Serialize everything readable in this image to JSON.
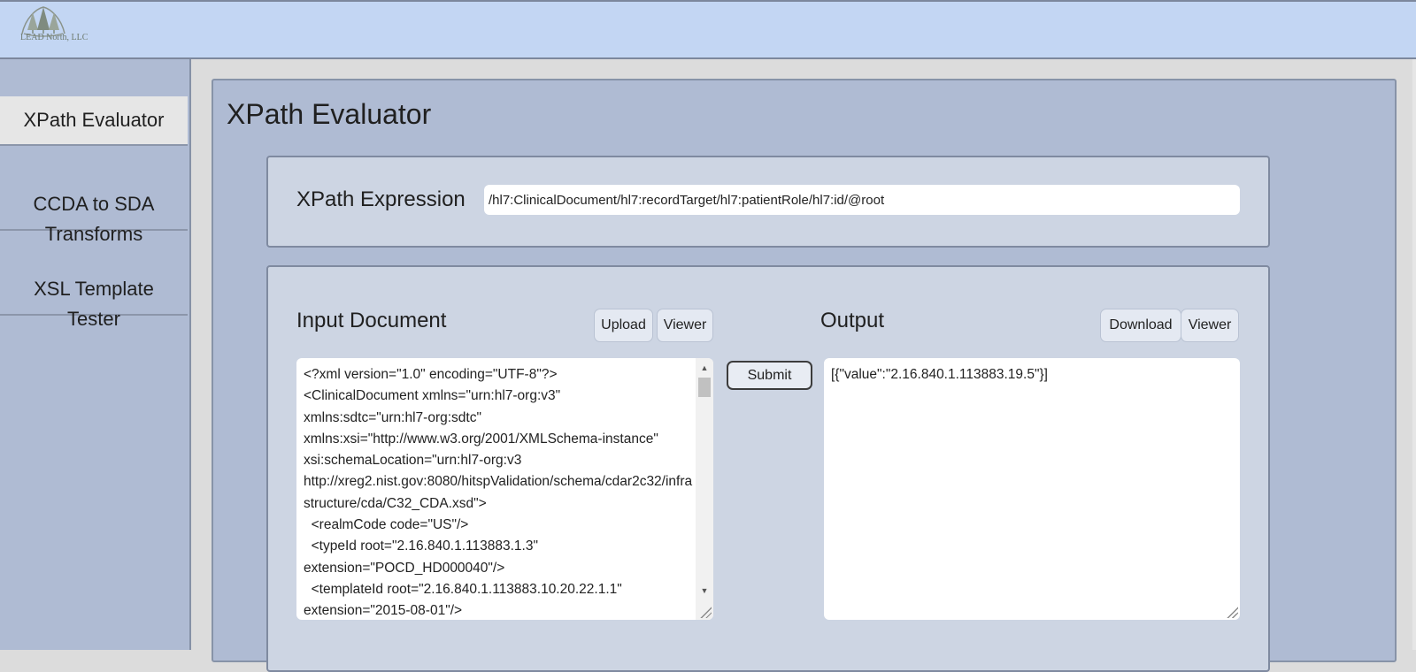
{
  "header": {
    "logo_text": "LEAD North, LLC"
  },
  "sidebar": {
    "items": [
      {
        "label": "XPath Evaluator",
        "active": true
      },
      {
        "label": "CCDA to SDA\nTransforms",
        "active": false
      },
      {
        "label": "XSL Template\nTester",
        "active": false
      }
    ]
  },
  "main": {
    "title": "XPath Evaluator",
    "xpath": {
      "label": "XPath Expression",
      "value": "/hl7:ClinicalDocument/hl7:recordTarget/hl7:patientRole/hl7:id/@root"
    },
    "input": {
      "label": "Input Document",
      "upload_label": "Upload",
      "viewer_label": "Viewer",
      "content": "<?xml version=\"1.0\" encoding=\"UTF-8\"?>\n<ClinicalDocument xmlns=\"urn:hl7-org:v3\"\nxmlns:sdtc=\"urn:hl7-org:sdtc\"\nxmlns:xsi=\"http://www.w3.org/2001/XMLSchema-instance\"\nxsi:schemaLocation=\"urn:hl7-org:v3\nhttp://xreg2.nist.gov:8080/hitspValidation/schema/cdar2c32/infrastructure/cda/C32_CDA.xsd\">\n  <realmCode code=\"US\"/>\n  <typeId root=\"2.16.840.1.113883.1.3\"\nextension=\"POCD_HD000040\"/>\n  <templateId root=\"2.16.840.1.113883.10.20.22.1.1\"\nextension=\"2015-08-01\"/>"
    },
    "submit_label": "Submit",
    "output": {
      "label": "Output",
      "download_label": "Download",
      "viewer_label": "Viewer",
      "content": "[{\"value\":\"2.16.840.1.113883.19.5\"}]"
    }
  }
}
